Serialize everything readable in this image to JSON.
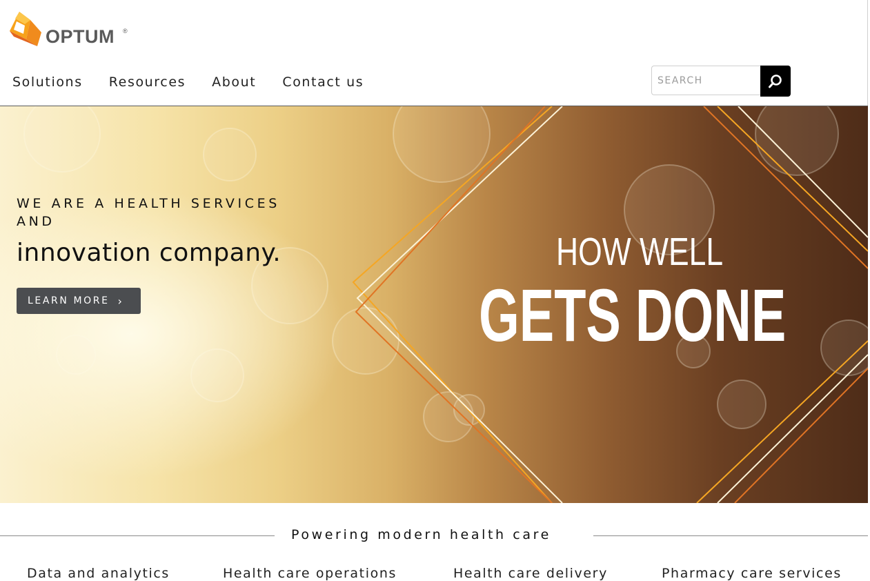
{
  "brand": {
    "name": "OPTUM",
    "registered": "®"
  },
  "nav": [
    {
      "label": "Solutions"
    },
    {
      "label": "Resources"
    },
    {
      "label": "About"
    },
    {
      "label": "Contact us"
    }
  ],
  "search": {
    "placeholder": "SEARCH",
    "value": ""
  },
  "hero": {
    "kicker": "WE ARE A HEALTH SERVICES AND",
    "heading": "innovation company.",
    "cta_label": "LEARN MORE",
    "tagline_top": "HOW WELL",
    "tagline_bottom": "GETS DONE"
  },
  "section": {
    "title": "Powering modern health care",
    "categories": [
      {
        "label": "Data and analytics"
      },
      {
        "label": "Health care operations"
      },
      {
        "label": "Health care delivery"
      },
      {
        "label": "Pharmacy care services"
      }
    ]
  },
  "colors": {
    "accent_orange": "#f39c12",
    "logo_text": "#5a5a5a",
    "search_button": "#000000",
    "cta_button": "#4b4d50"
  }
}
